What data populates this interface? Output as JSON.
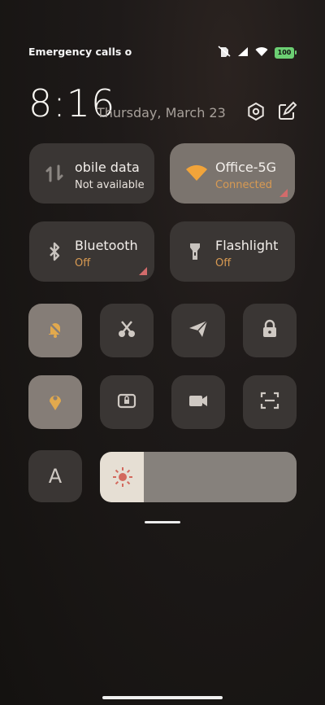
{
  "status": {
    "carrier": "Emergency calls o",
    "battery": "100",
    "icons": [
      "vibrate-off-icon",
      "signal-icon",
      "wifi-icon",
      "battery-icon"
    ]
  },
  "header": {
    "time": "8:16",
    "date": "Thursday, March 23",
    "settings_icon": "gear-icon",
    "edit_icon": "edit-icon"
  },
  "tiles": {
    "mobile_data": {
      "title": "obile data",
      "status": "Not available"
    },
    "wifi": {
      "title": "Office-5G",
      "status": "Connected"
    },
    "bluetooth": {
      "title": "Bluetooth",
      "status": "Off"
    },
    "flashlight": {
      "title": "Flashlight",
      "status": "Off"
    }
  },
  "toggles": [
    "bell-off",
    "scissors",
    "send",
    "lock",
    "location",
    "screen-lock",
    "video",
    "scan"
  ],
  "font_button": {
    "label": "A"
  },
  "brightness": {
    "level": 0.22
  },
  "colors": {
    "accent": "#d89a52",
    "active_tile": "#7b746e",
    "tile": "#3a3634"
  }
}
